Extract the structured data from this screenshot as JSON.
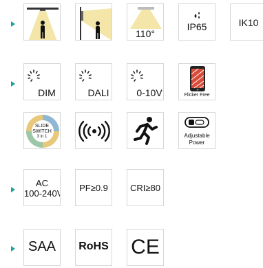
{
  "colors": {
    "bullet": "#1aa39a",
    "tile_border": "#d6d6d6",
    "warm_light": "#f3e6a8"
  },
  "rows": [
    {
      "tiles": [
        {
          "icon": "ceiling-light-person-icon"
        },
        {
          "icon": "wall-light-person-icon"
        },
        {
          "icon": "beam-angle-icon",
          "label": "110°"
        },
        {
          "icon": "ip-rating-icon",
          "label": "IP65"
        },
        {
          "icon": "impact-rating-icon",
          "label": "IK10"
        }
      ]
    },
    {
      "tiles": [
        {
          "icon": "dimming-icon",
          "label": "DIM"
        },
        {
          "icon": "dimming-icon",
          "label": "DALI"
        },
        {
          "icon": "dimming-icon",
          "label": "0-10V"
        },
        {
          "icon": "phone-icon",
          "label": "Flicker Free"
        }
      ]
    },
    {
      "tiles": [
        {
          "icon": "slide-switch-badge-icon",
          "label_top": "SLIDE",
          "label_mid": "SWITCH",
          "label_bot": "3 in 1"
        },
        {
          "icon": "sensor-waves-icon"
        },
        {
          "icon": "running-man-icon"
        },
        {
          "icon": "battery-switch-icon",
          "label": "Adjustable",
          "label2": "Power"
        }
      ]
    },
    {
      "tiles": [
        {
          "icon": "none",
          "label": "AC",
          "label2": "100-240V"
        },
        {
          "icon": "none",
          "label": "PF≥0.9"
        },
        {
          "icon": "none",
          "label": "CRI≥80"
        }
      ]
    },
    {
      "tiles": [
        {
          "icon": "saa-mark",
          "label": "SAA"
        },
        {
          "icon": "rohs-mark",
          "label": "RoHS"
        },
        {
          "icon": "ce-mark",
          "label": "CE"
        }
      ]
    }
  ]
}
